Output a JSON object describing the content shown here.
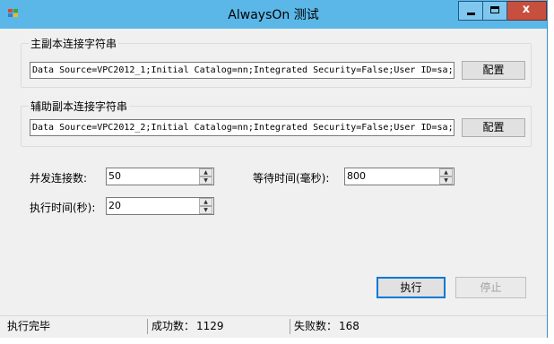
{
  "window": {
    "title": "AlwaysOn 测试",
    "close_glyph": "x",
    "icon_colors": [
      "#d54a2f",
      "#3ba43b",
      "#2f7fd5",
      "#f1b81d"
    ]
  },
  "primary": {
    "group_title": "主副本连接字符串",
    "connection_string": "Data Source=VPC2012_1;Initial Catalog=nn;Integrated Security=False;User ID=sa;",
    "config_label": "配置"
  },
  "secondary": {
    "group_title": "辅助副本连接字符串",
    "connection_string": "Data Source=VPC2012_2;Initial Catalog=nn;Integrated Security=False;User ID=sa;",
    "config_label": "配置"
  },
  "settings": {
    "concurrency_label": "并发连接数:",
    "concurrency_value": "50",
    "wait_label": "等待时间(毫秒):",
    "wait_value": "800",
    "duration_label": "执行时间(秒):",
    "duration_value": "20"
  },
  "actions": {
    "execute_label": "执行",
    "stop_label": "停止"
  },
  "status": {
    "state": "执行完毕",
    "success_label": "成功数：",
    "success_count": "1129",
    "failure_label": "失败数：",
    "failure_count": "168"
  },
  "colors": {
    "titlebar": "#5bb7e8",
    "close_button": "#c74f3d",
    "focus_border": "#0078d7"
  }
}
